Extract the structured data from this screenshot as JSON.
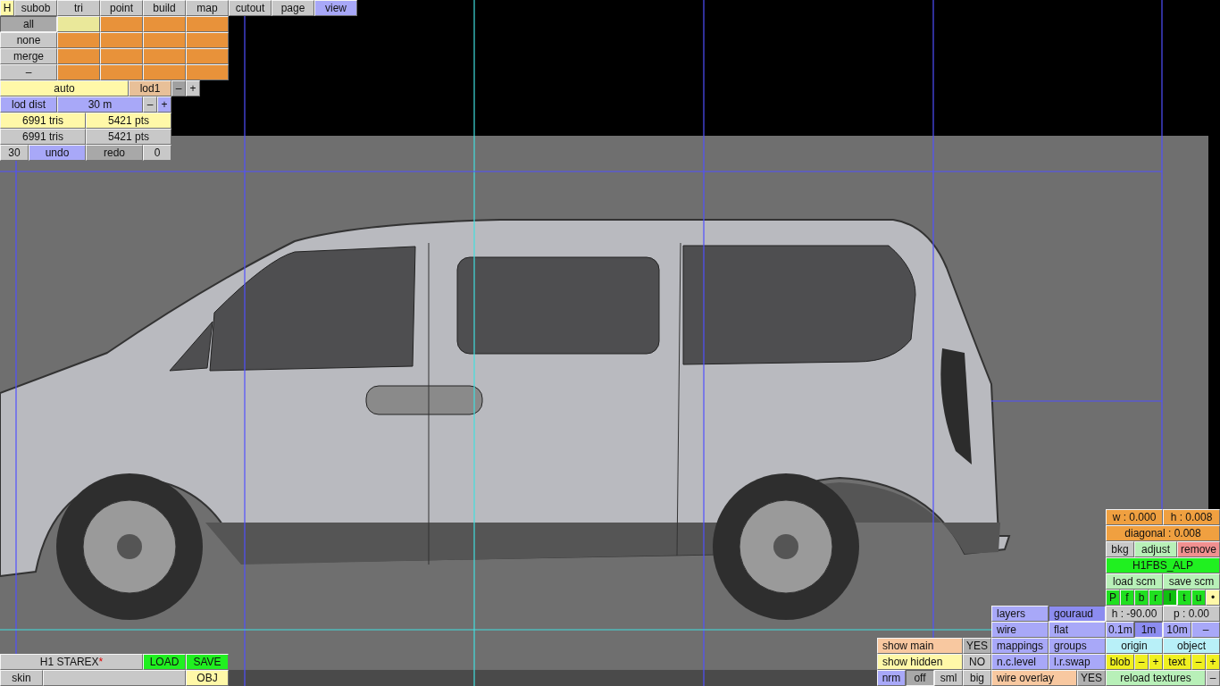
{
  "h_button": {
    "label": "H"
  },
  "tabs": [
    {
      "label": "subob",
      "selected": false
    },
    {
      "label": "tri",
      "selected": false
    },
    {
      "label": "point",
      "selected": false
    },
    {
      "label": "build",
      "selected": false
    },
    {
      "label": "map",
      "selected": false
    },
    {
      "label": "cutout",
      "selected": false
    },
    {
      "label": "page",
      "selected": false
    },
    {
      "label": "view",
      "selected": true
    }
  ],
  "selection_buttons": [
    {
      "label": "all",
      "selected": true
    },
    {
      "label": "none",
      "selected": false
    },
    {
      "label": "merge",
      "selected": false
    },
    {
      "label": "–",
      "selected": false
    }
  ],
  "subobject_grid": [
    [
      {
        "selected": true
      },
      {
        "selected": false
      },
      {
        "selected": false
      },
      {
        "selected": false
      }
    ],
    [
      {
        "selected": false
      },
      {
        "selected": false
      },
      {
        "selected": false
      },
      {
        "selected": false
      }
    ],
    [
      {
        "selected": false
      },
      {
        "selected": false
      },
      {
        "selected": false
      },
      {
        "selected": false
      }
    ],
    [
      {
        "selected": false
      },
      {
        "selected": false
      },
      {
        "selected": false
      },
      {
        "selected": false
      }
    ]
  ],
  "left_rows": [
    [
      {
        "label": "auto",
        "color": "#fff8a8"
      },
      {
        "label": "lod1",
        "color": "#e8c098"
      },
      {
        "label": "–",
        "color": "#a0a0a0"
      },
      {
        "label": "+",
        "color": "#c8c8c8"
      }
    ],
    [
      {
        "label": "lod dist",
        "color": "#a8a8f8"
      },
      {
        "label": "30 m",
        "color": "#a8a8f8"
      },
      {
        "label": "–",
        "color": "#c8c8c8"
      },
      {
        "label": "+",
        "color": "#a8a8f8"
      }
    ],
    [
      {
        "label": "6991 tris",
        "color": "#fff8a8"
      },
      {
        "label": "5421 pts",
        "color": "#fff8a8"
      }
    ],
    [
      {
        "label": "6991 tris",
        "color": "#c8c8c8"
      },
      {
        "label": "5421 pts",
        "color": "#c8c8c8"
      }
    ],
    [
      {
        "label": "30",
        "color": "#c8c8c8"
      },
      {
        "label": "undo",
        "color": "#a8a8f8"
      },
      {
        "label": "redo",
        "color": "#a8a8a8"
      },
      {
        "label": "0",
        "color": "#c8c8c8"
      }
    ]
  ],
  "file_panel": {
    "name": "H1 STAREX",
    "modified_mark": "*",
    "rows": [
      [
        {
          "label": "LOAD",
          "color": "#20f020"
        },
        {
          "label": "SAVE",
          "color": "#20f020"
        }
      ],
      [
        {
          "label": "skin",
          "color": "#c8c8c8"
        },
        {
          "color": "#c8c8c8"
        },
        {
          "label": "OBJ",
          "color": "#fff8a8"
        }
      ]
    ]
  },
  "property_rows": [
    [
      {
        "label": "w : 0.000",
        "color": "#f0a040"
      },
      {
        "label": "h : 0.008",
        "color": "#f0a040"
      }
    ],
    [
      {
        "label": "diagonal : 0.008",
        "color": "#f0a040"
      }
    ],
    [
      {
        "label": "bkg",
        "color": "#c8c8c8"
      },
      {
        "label": "adjust",
        "color": "#b8f0b8"
      },
      {
        "label": "remove",
        "color": "#f09090"
      }
    ],
    [
      {
        "label": "H1FBS_ALP",
        "color": "#20f020"
      }
    ],
    [
      {
        "label": "load scm",
        "color": "#b8f0b8"
      },
      {
        "label": "save scm",
        "color": "#b8f0b8"
      }
    ],
    [
      {
        "label": "P",
        "color": "#20e020",
        "selected": false
      },
      {
        "label": "f",
        "color": "#20e020",
        "selected": false
      },
      {
        "label": "b",
        "color": "#20e020",
        "selected": false
      },
      {
        "label": "r",
        "color": "#20e020",
        "selected": false
      },
      {
        "label": "l",
        "color": "#10c010",
        "selected": true
      },
      {
        "label": "t",
        "color": "#20e020",
        "selected": false
      },
      {
        "label": "u",
        "color": "#20e020",
        "selected": false
      },
      {
        "label": "•",
        "color": "#fff8a8",
        "selected": false
      }
    ],
    [
      {
        "label": "h : -90.00",
        "color": "#c8c8c8"
      },
      {
        "label": "p : 0.00",
        "color": "#c8c8c8"
      }
    ],
    [
      {
        "label": "0.1m",
        "color": "#a8a8f8",
        "selected": false
      },
      {
        "label": "1m",
        "color": "#8c8cf0",
        "selected": true
      },
      {
        "label": "10m",
        "color": "#a8a8f8",
        "selected": false
      },
      {
        "label": "–",
        "color": "#a8a8f8",
        "selected": false
      }
    ],
    [
      {
        "label": "origin",
        "color": "#b8f0f8"
      },
      {
        "label": "object",
        "color": "#b8f0f8"
      }
    ],
    [
      {
        "label": "blob",
        "color": "#f0f020"
      },
      {
        "label": "–",
        "color": "#f0f020"
      },
      {
        "label": "+",
        "color": "#f0f020"
      },
      {
        "label": "text",
        "color": "#f0f020"
      },
      {
        "label": "–",
        "color": "#f0f020"
      },
      {
        "label": "+",
        "color": "#f0f020"
      }
    ],
    [
      {
        "label": "reload textures",
        "color": "#b8f0b8"
      },
      {
        "label": "–",
        "color": "#c8c8c8"
      }
    ]
  ],
  "render_rows": [
    [
      {
        "label": "layers",
        "color": "#a8a8f8",
        "selected": false
      },
      {
        "label": "gouraud",
        "color": "#8c8cf0",
        "selected": true
      }
    ],
    [
      {
        "label": "wire",
        "color": "#a8a8f8",
        "selected": false
      },
      {
        "label": "flat",
        "color": "#a8a8f8",
        "selected": false
      }
    ],
    [
      {
        "label": "mappings",
        "color": "#a8a8f8"
      },
      {
        "label": "groups",
        "color": "#a8a8f8"
      }
    ],
    [
      {
        "label": "n.c.level",
        "color": "#a8a8f8"
      },
      {
        "label": "l.r.swap",
        "color": "#a8a8f8"
      }
    ],
    [
      {
        "label": "wire overlay",
        "color": "#f8c8a0"
      },
      {
        "label": "YES",
        "color": "#b0b0b0"
      }
    ]
  ],
  "display_rows": [
    [
      {
        "label": "show main",
        "color": "#f8c8a0"
      },
      {
        "label": "YES",
        "color": "#b0b0b0"
      }
    ],
    [
      {
        "label": "show hidden",
        "color": "#fff8a8"
      },
      {
        "label": "NO",
        "color": "#c8c8c8"
      }
    ],
    [
      {
        "label": "nrm",
        "color": "#a8a8f8",
        "selected": false
      },
      {
        "label": "off",
        "color": "#a8a8a8",
        "selected": true
      },
      {
        "label": "sml",
        "color": "#c8c8c8",
        "selected": false
      },
      {
        "label": "big",
        "color": "#c8c8c8",
        "selected": false
      }
    ]
  ]
}
